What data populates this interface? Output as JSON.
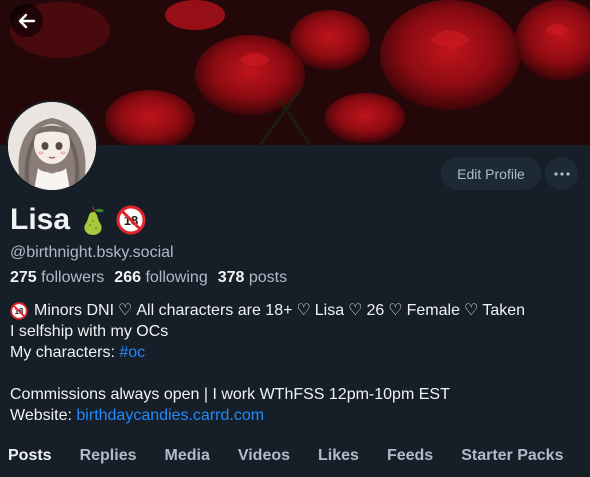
{
  "profile": {
    "name": "Lisa",
    "handle": "@birthnight.bsky.social",
    "stats": {
      "followers_count": "275",
      "followers_label": "followers",
      "following_count": "266",
      "following_label": "following",
      "posts_count": "378",
      "posts_label": "posts"
    },
    "badges": [
      "pear-emoji-icon",
      "no-under-18-icon"
    ]
  },
  "actions": {
    "edit_profile": "Edit Profile"
  },
  "bio": {
    "line1_parts": [
      "Minors DNI",
      "All characters are 18+",
      "Lisa",
      "26",
      "Female",
      "Taken"
    ],
    "line2": "I selfship with my OCs",
    "line3_prefix": "My characters: ",
    "line3_tag": "#oc",
    "line5": "Commissions always open | I work WThFSS 12pm-10pm EST",
    "line6_prefix": "Website: ",
    "line6_link": "birthdaycandies.carrd.com"
  },
  "tabs": [
    "Posts",
    "Replies",
    "Media",
    "Videos",
    "Likes",
    "Feeds",
    "Starter Packs"
  ],
  "active_tab": "Posts",
  "colors": {
    "background": "#161e27",
    "accent_link": "#208bfe",
    "muted_text": "#aebbc9",
    "button_bg": "#1e2937"
  }
}
